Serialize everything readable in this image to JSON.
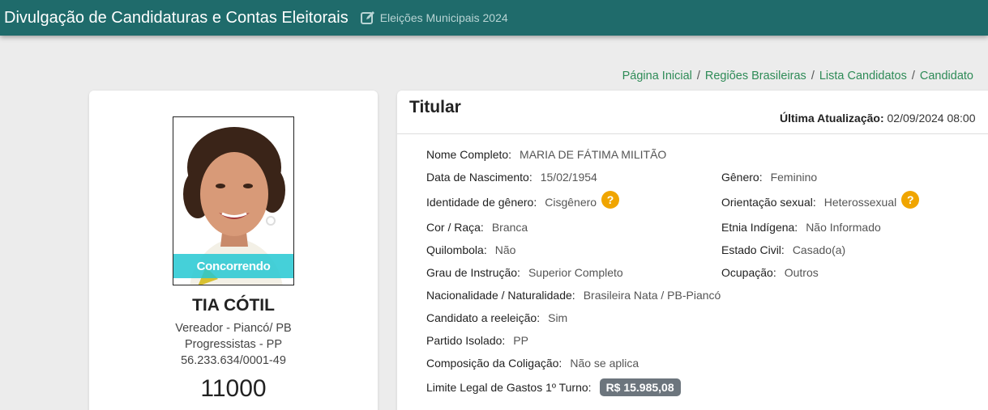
{
  "header": {
    "app_title": "Divulgação de Candidaturas e Contas Eleitorais",
    "election": "Eleições Municipais 2024",
    "icon": "edit-icon"
  },
  "breadcrumb": {
    "items": [
      "Página Inicial",
      "Regiões Brasileiras",
      "Lista Candidatos"
    ],
    "separator": "/",
    "current": "Candidato"
  },
  "candidate": {
    "status": "Concorrendo",
    "name": "TIA CÓTIL",
    "office": "Vereador - Piancó/ PB",
    "party": "Progressistas - PP",
    "cnpj": "56.233.634/0001-49",
    "number": "11000"
  },
  "details": {
    "title": "Titular",
    "updated_label": "Última Atualização:",
    "updated_value": "02/09/2024 08:00",
    "fields": {
      "nome_completo": {
        "label": "Nome Completo:",
        "value": "MARIA DE FÁTIMA MILITÃO"
      },
      "data_nascimento": {
        "label": "Data de Nascimento:",
        "value": "15/02/1954"
      },
      "genero": {
        "label": "Gênero:",
        "value": "Feminino"
      },
      "identidade_genero": {
        "label": "Identidade de gênero:",
        "value": "Cisgênero"
      },
      "orientacao_sexual": {
        "label": "Orientação sexual:",
        "value": "Heterossexual"
      },
      "cor_raca": {
        "label": "Cor / Raça:",
        "value": "Branca"
      },
      "etnia_indigena": {
        "label": "Etnia Indígena:",
        "value": "Não Informado"
      },
      "quilombola": {
        "label": "Quilombola:",
        "value": "Não"
      },
      "estado_civil": {
        "label": "Estado Civil:",
        "value": "Casado(a)"
      },
      "grau_instrucao": {
        "label": "Grau de Instrução:",
        "value": "Superior Completo"
      },
      "ocupacao": {
        "label": "Ocupação:",
        "value": "Outros"
      },
      "nacionalidade": {
        "label": "Nacionalidade / Naturalidade:",
        "value": "Brasileira Nata / PB-Piancó"
      },
      "reeleicao": {
        "label": "Candidato a reeleição:",
        "value": "Sim"
      },
      "partido_isolado": {
        "label": "Partido Isolado:",
        "value": "PP"
      },
      "coligacao": {
        "label": "Composição da Coligação:",
        "value": "Não se aplica"
      },
      "limite_gastos": {
        "label": "Limite Legal de Gastos 1º Turno:",
        "value": "R$ 15.985,08"
      }
    },
    "help_glyph": "?"
  },
  "colors": {
    "topbar": "#1f6b6b",
    "link": "#2e8b57",
    "help_badge": "#f0a500",
    "status_band": "#24c8d2",
    "money_badge": "#6c757d"
  }
}
